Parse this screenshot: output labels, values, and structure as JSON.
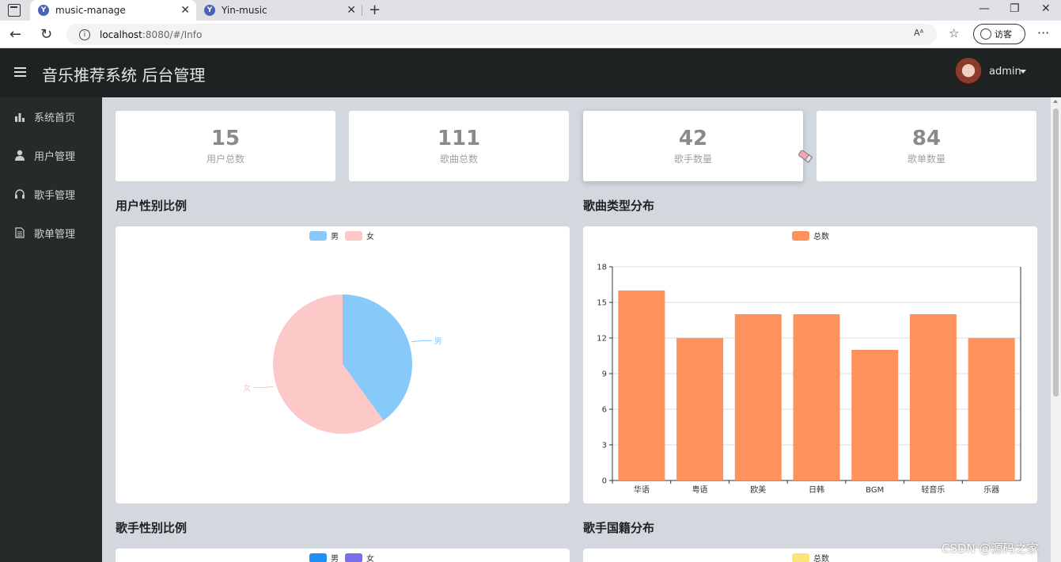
{
  "browser": {
    "tabs": [
      {
        "title": "music-manage",
        "active": true
      },
      {
        "title": "Yin-music",
        "active": false
      }
    ],
    "url_host": "localhost",
    "url_path": ":8080/#/Info",
    "read_aloud": "Aᴬ",
    "guest_label": "访客"
  },
  "header": {
    "title": "音乐推荐系统 后台管理",
    "user": "admin"
  },
  "sidebar": {
    "items": [
      {
        "label": "系统首页",
        "icon": "bar-chart-icon"
      },
      {
        "label": "用户管理",
        "icon": "user-icon"
      },
      {
        "label": "歌手管理",
        "icon": "headset-icon"
      },
      {
        "label": "歌单管理",
        "icon": "document-icon"
      }
    ]
  },
  "stats": [
    {
      "value": "15",
      "label": "用户总数"
    },
    {
      "value": "111",
      "label": "歌曲总数"
    },
    {
      "value": "42",
      "label": "歌手数量"
    },
    {
      "value": "84",
      "label": "歌单数量"
    }
  ],
  "sections": {
    "user_gender": "用户性别比例",
    "song_type": "歌曲类型分布",
    "singer_gender": "歌手性别比例",
    "singer_country": "歌手国籍分布"
  },
  "chart_data": [
    {
      "type": "pie",
      "title": "用户性别比例",
      "labels": [
        "男",
        "女"
      ],
      "values": [
        6,
        9
      ],
      "colors": [
        "#87c9f9",
        "#fcc8c8"
      ],
      "legend": "top-center"
    },
    {
      "type": "bar",
      "title": "歌曲类型分布",
      "categories": [
        "华语",
        "粤语",
        "欧美",
        "日韩",
        "BGM",
        "轻音乐",
        "乐器"
      ],
      "series": [
        {
          "name": "总数",
          "values": [
            16,
            12,
            14,
            14,
            11,
            14,
            12
          ]
        }
      ],
      "ylim": [
        0,
        18
      ],
      "yticks": [
        0,
        3,
        6,
        9,
        12,
        15,
        18
      ],
      "color": "#ff915c",
      "legend": "top-center"
    },
    {
      "type": "pie",
      "title": "歌手性别比例",
      "labels": [
        "男",
        "女"
      ],
      "colors": [
        "#1e8ff5",
        "#7b6fe8"
      ],
      "legend": "top-center"
    },
    {
      "type": "bar",
      "title": "歌手国籍分布",
      "series": [
        {
          "name": "总数"
        }
      ],
      "color": "#fde47a",
      "legend": "top-center"
    }
  ],
  "watermark": "CSDN @源码之家"
}
